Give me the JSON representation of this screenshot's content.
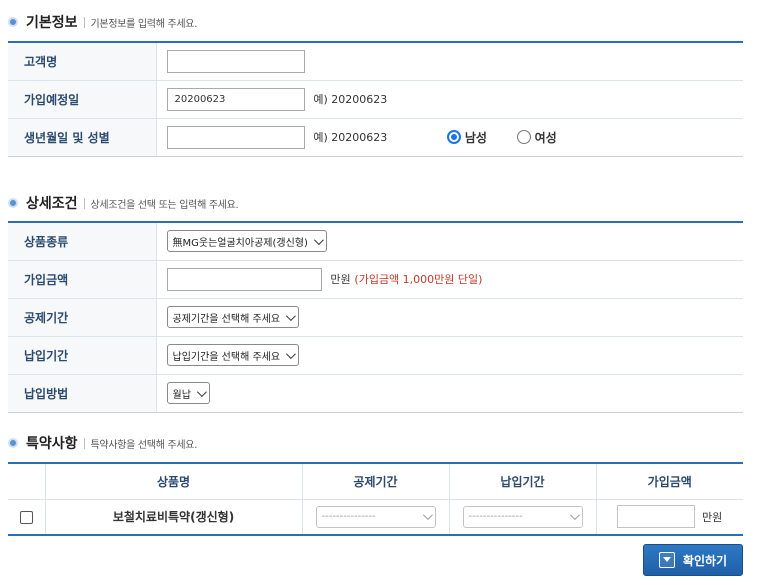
{
  "basic": {
    "title": "기본정보",
    "desc": "기본정보를 입력해 주세요.",
    "rows": {
      "name_label": "고객명",
      "join_date_label": "가입예정일",
      "join_date_value": "20200623",
      "join_date_hint": "예) 20200623",
      "birth_label": "생년월일 및 성별",
      "birth_hint": "예) 20200623",
      "gender_male": "남성",
      "gender_female": "여성",
      "gender_selected": "남성"
    }
  },
  "detail": {
    "title": "상세조건",
    "desc": "상세조건을 선택 또는 입력해 주세요.",
    "product_label": "상품종류",
    "product_value": "無MG웃는얼굴치아공제(갱신형)",
    "amount_label": "가입금액",
    "amount_unit": "만원",
    "amount_note": "(가입금액 1,000만원 단일)",
    "period_label": "공제기간",
    "period_value": "공제기간을 선택해 주세요",
    "pay_period_label": "납입기간",
    "pay_period_value": "납입기간을 선택해 주세요",
    "pay_method_label": "납입방법",
    "pay_method_value": "월납"
  },
  "rider": {
    "title": "특약사항",
    "desc": "특약사항을 선택해 주세요.",
    "headers": [
      "상품명",
      "공제기간",
      "납입기간",
      "가입금액"
    ],
    "row": {
      "name": "보철치료비특약(갱신형)",
      "period": "---------------",
      "pay_period": "---------------",
      "unit": "만원"
    }
  },
  "confirm_label": "확인하기"
}
